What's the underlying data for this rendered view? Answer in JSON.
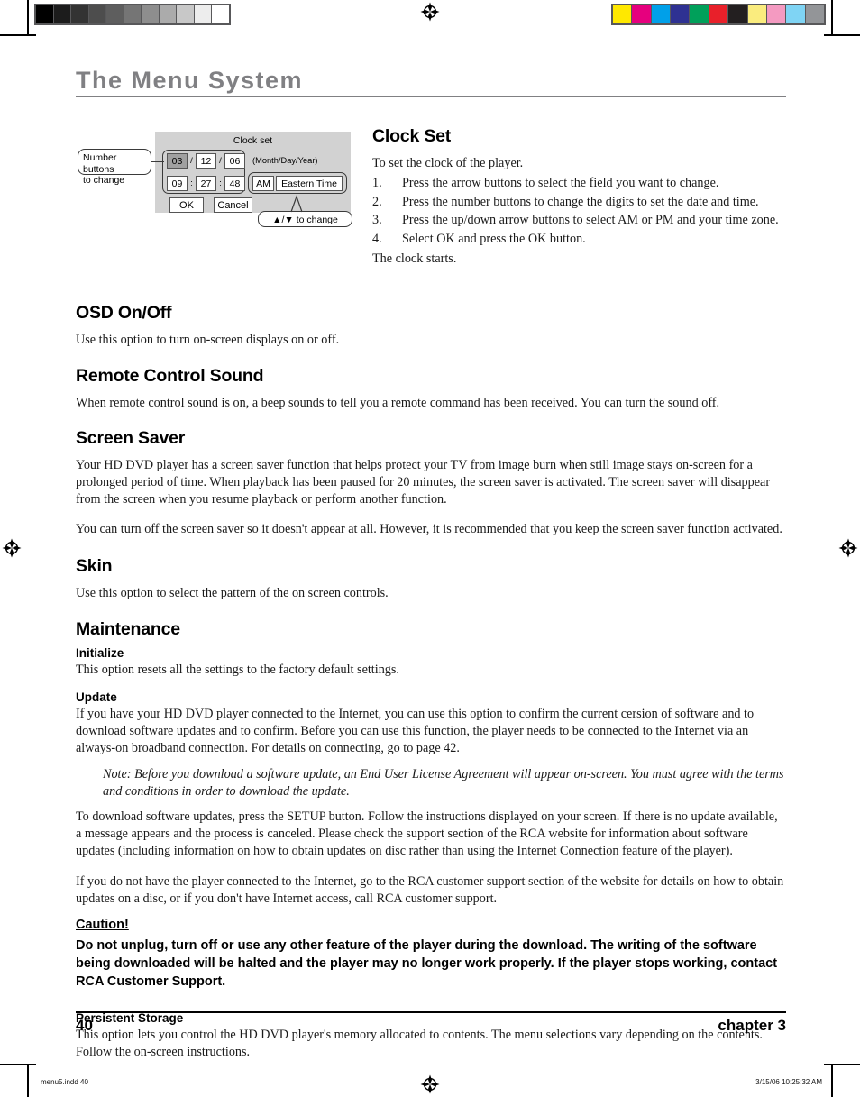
{
  "print_marks": {
    "gray_bar_swatches": [
      "#000000",
      "#1c1c1c",
      "#333333",
      "#4d4d4d",
      "#5e5e5e",
      "#757575",
      "#8e8e8e",
      "#ababab",
      "#c8c8c8",
      "#ededed",
      "#ffffff"
    ],
    "color_bar_swatches": [
      "#ffe800",
      "#e6007e",
      "#00a0e9",
      "#2e3192",
      "#00a05a",
      "#e8202a",
      "#231f20",
      "#faec7e",
      "#f49ac1",
      "#7fd4f4",
      "#939598"
    ],
    "registration_icon": "registration-target-icon"
  },
  "header": {
    "title": "The Menu System"
  },
  "figure": {
    "osd_title": "Clock set",
    "date": {
      "month": "03",
      "day": "12",
      "year": "06",
      "sep": "/"
    },
    "time": {
      "hour": "09",
      "minute": "27",
      "second": "48",
      "sep": ":"
    },
    "ampm": "AM",
    "timezone": "Eastern Time",
    "format_label": "(Month/Day/Year)",
    "ok_label": "OK",
    "cancel_label": "Cancel",
    "callout_left": "Number buttons to change",
    "callout_left_line1": "Number buttons",
    "callout_left_line2": "to change",
    "callout_right": "▲/▼ to change"
  },
  "sections": {
    "clock_set": {
      "heading": "Clock Set",
      "intro": "To set the clock of the player.",
      "steps": [
        {
          "num": "1.",
          "text": "Press the arrow buttons to select the field you want to change."
        },
        {
          "num": "2.",
          "text": "Press the number buttons to change the digits to set the date and time."
        },
        {
          "num": "3.",
          "text": "Press the up/down arrow buttons to select AM or PM and your time zone."
        },
        {
          "num": "4.",
          "text": "Select OK and press the OK button."
        }
      ],
      "closing": "The clock starts."
    },
    "osd_on_off": {
      "heading": "OSD On/Off",
      "body": "Use this option to turn on-screen displays on or off."
    },
    "remote_control_sound": {
      "heading": "Remote Control Sound",
      "body": "When remote control sound is on, a beep sounds to tell you a remote command has been received. You can turn the sound off."
    },
    "screen_saver": {
      "heading": "Screen Saver",
      "body1": "Your HD DVD player has a screen saver function that helps protect your TV from image burn when still image stays on-screen for a prolonged period of time. When playback has been paused for 20 minutes, the screen saver is activated. The screen saver will disappear from the screen when you resume playback or perform another function.",
      "body2": "You can turn off the screen saver so it doesn't appear at all. However, it is recommended that you keep the screen saver function activated."
    },
    "skin": {
      "heading": "Skin",
      "body": "Use this option to select the pattern of the on screen controls."
    },
    "maintenance": {
      "heading": "Maintenance",
      "initialize": {
        "heading": "Initialize",
        "body": "This option resets all the settings to the factory default settings."
      },
      "update": {
        "heading": "Update",
        "body1": "If you have your HD DVD player connected to the Internet, you can use this option to confirm the current cersion of software and to download software updates and to confirm. Before you can use this function, the player needs to be connected to the Internet via an always-on broadband connection. For details on connecting, go to page 42.",
        "note": "Note: Before you download a software update, an End User License Agreement will appear on-screen. You must agree with the terms and conditions in order to download the update.",
        "body2": "To download software updates, press the SETUP button. Follow the instructions displayed on your screen. If there is no update available, a message appears and the process is canceled. Please check the support section of the RCA website for information about software updates (including information on how to obtain updates on disc rather than using the Internet Connection feature of the player).",
        "body3": "If you do not have the player connected to the Internet, go to the RCA customer support section of the website for details on how to obtain updates on a disc, or if you don't have Internet access, call RCA customer support."
      },
      "caution": {
        "heading": "Caution!",
        "body": "Do not unplug, turn off or use any other feature of the player during the download. The writing of the software being downloaded will be halted and the player may no longer work properly. If the player stops working, contact RCA Customer Support."
      },
      "persistent_storage": {
        "heading": "Persistent Storage",
        "body": "This option lets you control the HD DVD player's memory allocated to contents. The menu selections vary depending on the contents. Follow the on-screen instructions."
      }
    }
  },
  "footer": {
    "page_number": "40",
    "chapter": "chapter 3",
    "slug_file": "menu5.indd   40",
    "slug_date": "3/15/06   10:25:32 AM"
  }
}
